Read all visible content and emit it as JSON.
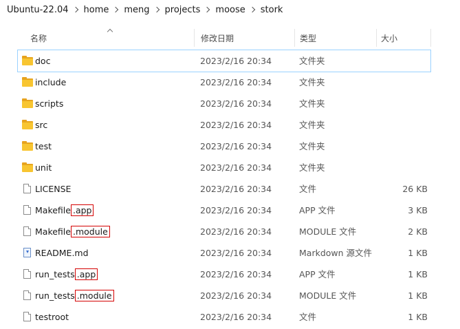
{
  "breadcrumb": [
    "Ubuntu-22.04",
    "home",
    "meng",
    "projects",
    "moose",
    "stork"
  ],
  "columns": {
    "name": "名称",
    "date": "修改日期",
    "type": "类型",
    "size": "大小"
  },
  "files": [
    {
      "icon": "folder-icon",
      "name": "doc",
      "ext": "",
      "date": "2023/2/16 20:34",
      "type": "文件夹",
      "size": "",
      "selected": true
    },
    {
      "icon": "folder-icon",
      "name": "include",
      "ext": "",
      "date": "2023/2/16 20:34",
      "type": "文件夹",
      "size": ""
    },
    {
      "icon": "folder-icon",
      "name": "scripts",
      "ext": "",
      "date": "2023/2/16 20:34",
      "type": "文件夹",
      "size": ""
    },
    {
      "icon": "folder-icon",
      "name": "src",
      "ext": "",
      "date": "2023/2/16 20:34",
      "type": "文件夹",
      "size": ""
    },
    {
      "icon": "folder-icon",
      "name": "test",
      "ext": "",
      "date": "2023/2/16 20:34",
      "type": "文件夹",
      "size": ""
    },
    {
      "icon": "folder-icon",
      "name": "unit",
      "ext": "",
      "date": "2023/2/16 20:34",
      "type": "文件夹",
      "size": ""
    },
    {
      "icon": "file-icon",
      "name": "LICENSE",
      "ext": "",
      "date": "2023/2/16 20:34",
      "type": "文件",
      "size": "26 KB"
    },
    {
      "icon": "file-icon",
      "name": "Makefile",
      "ext": ".app",
      "date": "2023/2/16 20:34",
      "type": "APP 文件",
      "size": "3 KB"
    },
    {
      "icon": "file-icon",
      "name": "Makefile",
      "ext": ".module",
      "date": "2023/2/16 20:34",
      "type": "MODULE 文件",
      "size": "2 KB"
    },
    {
      "icon": "markdown-file-icon",
      "name": "README.md",
      "ext": "",
      "date": "2023/2/16 20:34",
      "type": "Markdown 源文件",
      "size": "1 KB"
    },
    {
      "icon": "file-icon",
      "name": "run_tests",
      "ext": ".app",
      "date": "2023/2/16 20:34",
      "type": "APP 文件",
      "size": "1 KB"
    },
    {
      "icon": "file-icon",
      "name": "run_tests",
      "ext": ".module",
      "date": "2023/2/16 20:34",
      "type": "MODULE 文件",
      "size": "1 KB"
    },
    {
      "icon": "file-icon",
      "name": "testroot",
      "ext": "",
      "date": "2023/2/16 20:34",
      "type": "文件",
      "size": "1 KB"
    }
  ],
  "colors": {
    "selection_border": "#99d1ff",
    "highlight_box": "#d40000",
    "folder": "#f8c531"
  }
}
